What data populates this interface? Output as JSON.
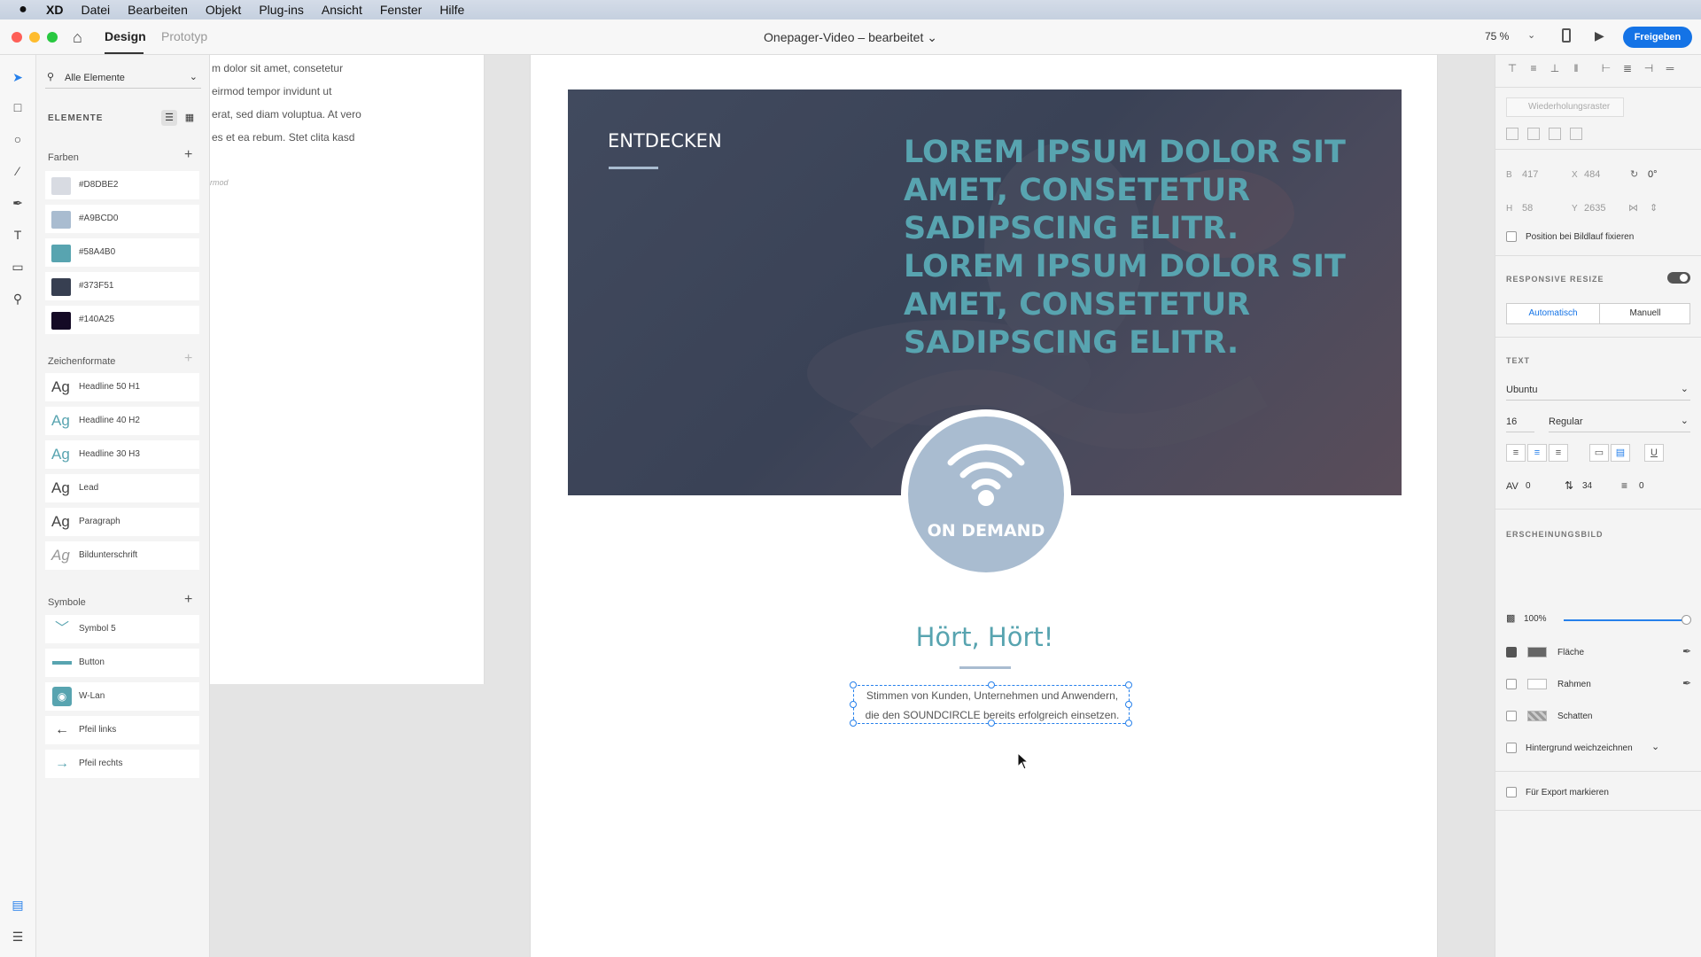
{
  "menubar": {
    "apple": "",
    "app": "XD",
    "items": [
      "Datei",
      "Bearbeiten",
      "Objekt",
      "Plug-ins",
      "Ansicht",
      "Fenster",
      "Hilfe"
    ]
  },
  "titlebar": {
    "tabs": [
      "Design",
      "Prototyp"
    ],
    "document_title": "Onepager-Video – bearbeitet ⌄",
    "zoom": "75 %",
    "share_label": "Freigeben"
  },
  "assets": {
    "search_label": "Alle Elemente",
    "elements_label": "ELEMENTE",
    "colors_title": "Farben",
    "colors": [
      {
        "hex": "#D8DBE2",
        "label": "#D8DBE2"
      },
      {
        "hex": "#A9BCD0",
        "label": "#A9BCD0"
      },
      {
        "hex": "#58A4B0",
        "label": "#58A4B0"
      },
      {
        "hex": "#373F51",
        "label": "#373F51"
      },
      {
        "hex": "#140A25",
        "label": "#140A25"
      }
    ],
    "char_styles_title": "Zeichenformate",
    "char_styles": [
      {
        "glyph": "Ag",
        "label": "Headline 50 H1"
      },
      {
        "glyph": "Ag",
        "label": "Headline 40 H2"
      },
      {
        "glyph": "Ag",
        "label": "Headline 30 H3"
      },
      {
        "glyph": "Ag",
        "label": "Lead"
      },
      {
        "glyph": "Ag",
        "label": "Paragraph"
      },
      {
        "glyph": "Ag",
        "label": "Bildunterschrift"
      }
    ],
    "symbols_title": "Symbole",
    "symbols": [
      {
        "icon": "chevron-symbol-icon",
        "label": "Symbol 5"
      },
      {
        "icon": "button-symbol-icon",
        "label": "Button"
      },
      {
        "icon": "wifi-symbol-icon",
        "label": "W-Lan"
      },
      {
        "icon": "arrow-left-icon",
        "label": "Pfeil links"
      },
      {
        "icon": "arrow-right-icon",
        "label": "Pfeil rechts"
      }
    ]
  },
  "paper": {
    "lines": [
      "m dolor sit amet, consetetur",
      "eirmod tempor invidunt ut",
      "erat, sed diam voluptua. At vero",
      "es et ea rebum. Stet clita kasd"
    ],
    "small": "rmod"
  },
  "artboard": {
    "kicker": "ENTDECKEN",
    "headline": "LOREM IPSUM DOLOR SIT AMET, CONSETETUR SADIPSCING ELITR. LOREM IPSUM DOLOR SIT AMET, CONSETETUR SADIPSCING ELITR.",
    "badge_text": "ON DEMAND",
    "section_title": "Hört, Hört!",
    "body_lines": [
      "Stimmen von Kunden, Unternehmen und Anwendern,",
      "die den SOUNDCIRCLE bereits erfolgreich einsetzen."
    ]
  },
  "inspector": {
    "repeat_grid": "Wiederholungsraster",
    "w_label": "B",
    "w_value": "417",
    "x_label": "X",
    "x_value": "484",
    "rotation": "0°",
    "h_label": "H",
    "h_value": "58",
    "y_label": "Y",
    "y_value": "2635",
    "fix_position": "Position bei Bildlauf fixieren",
    "responsive_resize": "RESPONSIVE RESIZE",
    "auto_label": "Automatisch",
    "manual_label": "Manuell",
    "text_head": "TEXT",
    "font_family": "Ubuntu",
    "font_size": "16",
    "font_weight": "Regular",
    "char_spacing": "0",
    "line_spacing": "34",
    "para_spacing": "0",
    "appearance_head": "ERSCHEINUNGSBILD",
    "opacity": "100%",
    "fill_label": "Fläche",
    "border_label": "Rahmen",
    "shadow_label": "Schatten",
    "blur_label": "Hintergrund weichzeichnen",
    "export_label": "Für Export markieren",
    "fill_color": "#666666"
  },
  "colors": {
    "accent": "#58A4B0",
    "secondary": "#A9BCD0",
    "hero_bg": "#3A4256",
    "selection": "#2680EB",
    "share_button": "#1473E6"
  }
}
